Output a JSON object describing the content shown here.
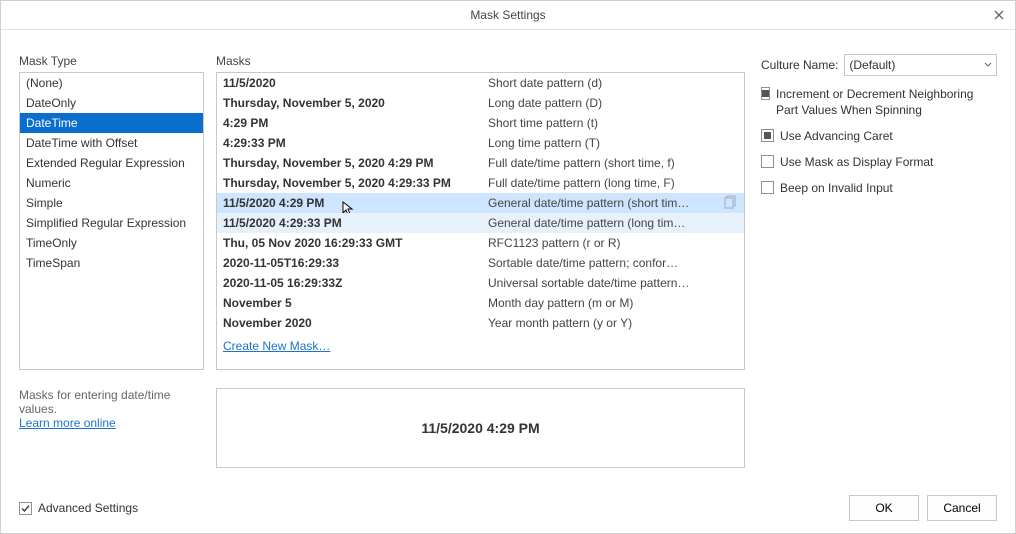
{
  "title": "Mask Settings",
  "section_mask_type": "Mask Type",
  "section_masks": "Masks",
  "mask_types": [
    "(None)",
    "DateOnly",
    "DateTime",
    "DateTime with Offset",
    "Extended Regular Expression",
    "Numeric",
    "Simple",
    "Simplified Regular Expression",
    "TimeOnly",
    "TimeSpan"
  ],
  "mask_type_selected_index": 2,
  "left_info_text": "Masks for entering date/time values.",
  "left_info_link": "Learn more online",
  "masks": [
    {
      "example": "11/5/2020",
      "desc": "Short date pattern (d)"
    },
    {
      "example": "Thursday, November 5, 2020",
      "desc": "Long date pattern (D)"
    },
    {
      "example": "4:29 PM",
      "desc": "Short time pattern (t)"
    },
    {
      "example": "4:29:33 PM",
      "desc": "Long time pattern (T)"
    },
    {
      "example": "Thursday, November 5, 2020 4:29 PM",
      "desc": "Full date/time pattern (short time, f)"
    },
    {
      "example": "Thursday, November 5, 2020 4:29:33 PM",
      "desc": "Full date/time pattern (long time, F)"
    },
    {
      "example": "11/5/2020 4:29 PM",
      "desc": "General date/time pattern (short tim…"
    },
    {
      "example": "11/5/2020 4:29:33 PM",
      "desc": "General date/time pattern (long tim…"
    },
    {
      "example": "Thu, 05 Nov 2020 16:29:33 GMT",
      "desc": "RFC1123 pattern (r or R)"
    },
    {
      "example": "2020-11-05T16:29:33",
      "desc": "Sortable date/time pattern; confor…"
    },
    {
      "example": "2020-11-05 16:29:33Z",
      "desc": "Universal sortable date/time pattern…"
    },
    {
      "example": "November 5",
      "desc": "Month day pattern (m or M)"
    },
    {
      "example": "November 2020",
      "desc": "Year month pattern (y or Y)"
    }
  ],
  "masks_selected_index": 6,
  "masks_hover_index": 7,
  "create_new_mask": "Create New Mask…",
  "preview_value": "11/5/2020 4:29 PM",
  "culture_label": "Culture Name:",
  "culture_value": "(Default)",
  "options": [
    {
      "label": "Increment or Decrement Neighboring Part Values When Spinning",
      "checked": true
    },
    {
      "label": "Use Advancing Caret",
      "checked": true
    },
    {
      "label": "Use Mask as Display Format",
      "checked": false
    },
    {
      "label": "Beep on Invalid Input",
      "checked": false
    }
  ],
  "advanced_settings_label": "Advanced Settings",
  "advanced_settings_checked": true,
  "ok_label": "OK",
  "cancel_label": "Cancel"
}
